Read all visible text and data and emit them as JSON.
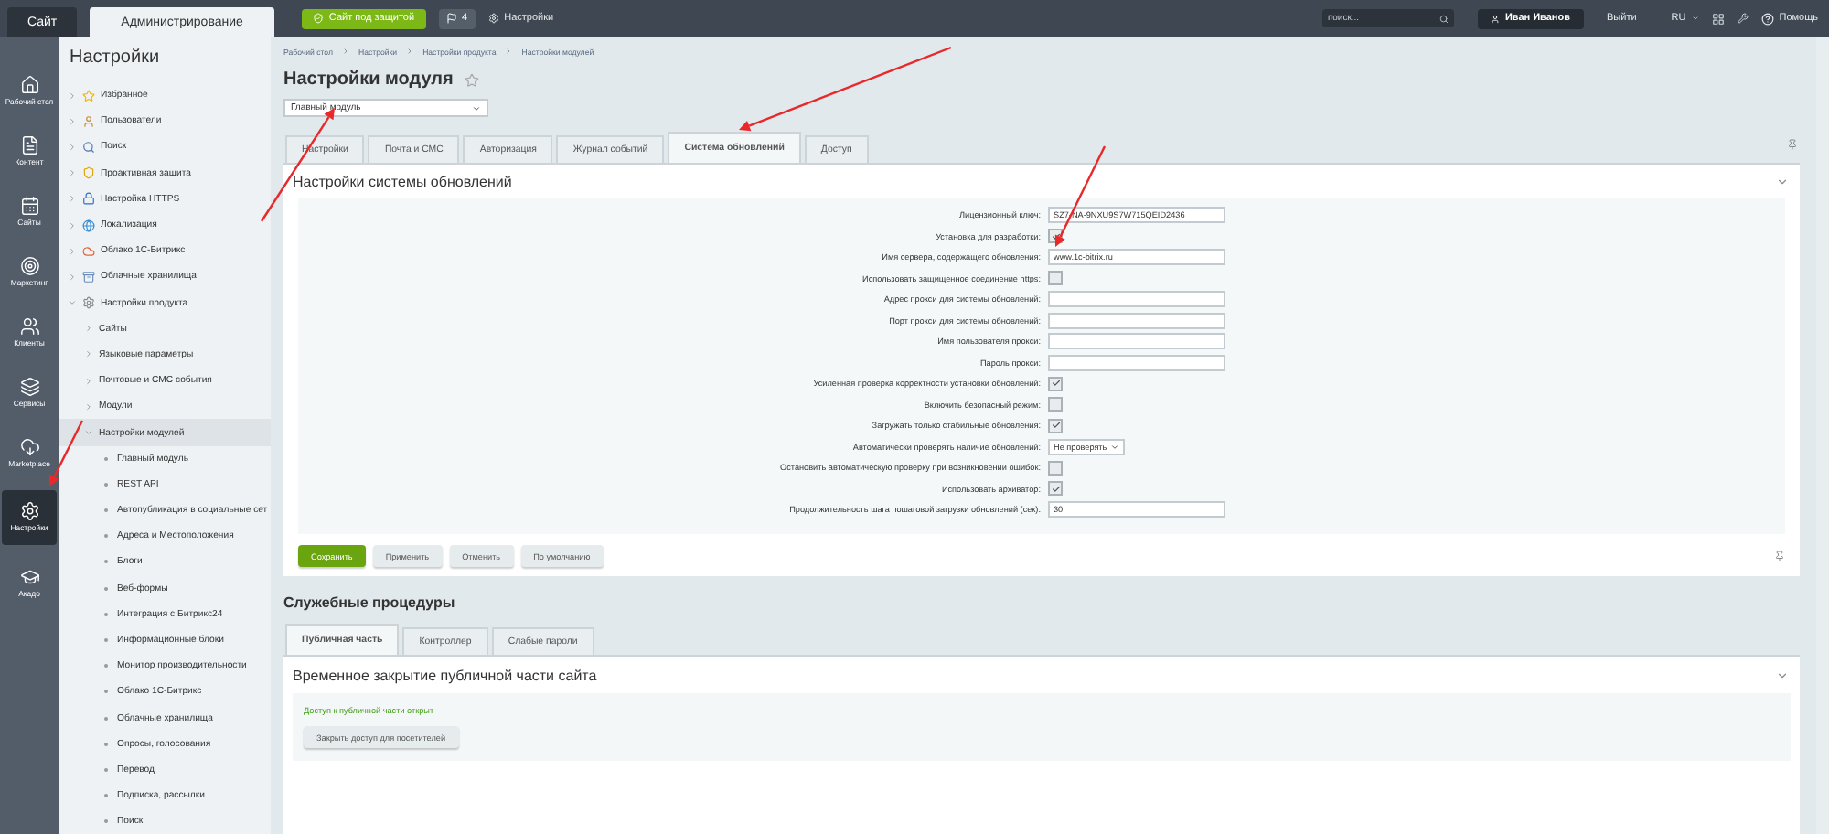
{
  "top_bar": {
    "tabs": [
      {
        "label": "Сайт",
        "selected": false
      },
      {
        "label": "Администрирование",
        "selected": true
      }
    ],
    "protection_button": "Сайт под защитой",
    "notifications_count": "4",
    "settings_link": "Настройки",
    "search": {
      "placeholder": "поиск..."
    },
    "user_name": "Иван Иванов",
    "logout": "Выйти",
    "language": "RU",
    "help": "Помощь"
  },
  "rail": [
    {
      "label": "Рабочий стол",
      "selected": false
    },
    {
      "label": "Контент",
      "selected": false
    },
    {
      "label": "Сайты",
      "selected": false
    },
    {
      "label": "Маркетинг",
      "selected": false
    },
    {
      "label": "Клиенты",
      "selected": false
    },
    {
      "label": "Сервисы",
      "selected": false
    },
    {
      "label": "Marketplace",
      "selected": false
    },
    {
      "label": "Настройки",
      "selected": true
    },
    {
      "label": "Акадо",
      "selected": false
    }
  ],
  "sidebar": {
    "title": "Настройки",
    "items": [
      {
        "label": "Избранное",
        "expanded": false,
        "selected": false
      },
      {
        "label": "Пользователи",
        "expanded": false,
        "selected": false
      },
      {
        "label": "Поиск",
        "expanded": false,
        "selected": false
      },
      {
        "label": "Проактивная защита",
        "expanded": false,
        "selected": false
      },
      {
        "label": "Настройка HTTPS",
        "expanded": false,
        "selected": false
      },
      {
        "label": "Локализация",
        "expanded": false,
        "selected": false
      },
      {
        "label": "Облако 1С-Битрикс",
        "expanded": false,
        "selected": false
      },
      {
        "label": "Облачные хранилища",
        "expanded": false,
        "selected": false
      },
      {
        "label": "Настройки продукта",
        "expanded": true,
        "selected": false,
        "children": [
          {
            "label": "Сайты",
            "expanded": false,
            "selected": false
          },
          {
            "label": "Языковые параметры",
            "expanded": false,
            "selected": false
          },
          {
            "label": "Почтовые и СМС события",
            "expanded": false,
            "selected": false
          },
          {
            "label": "Модули",
            "expanded": false,
            "selected": false
          },
          {
            "label": "Настройки модулей",
            "expanded": true,
            "selected": true,
            "children": [
              {
                "label": "Главный модуль",
                "selected": false
              },
              {
                "label": "REST API",
                "selected": false
              },
              {
                "label": "Автопубликация в социальные сет",
                "selected": false
              },
              {
                "label": "Адреса и Местоположения",
                "selected": false
              },
              {
                "label": "Блоги",
                "selected": false
              },
              {
                "label": "Веб-формы",
                "selected": false
              },
              {
                "label": "Интеграция с Битрикс24",
                "selected": false
              },
              {
                "label": "Информационные блоки",
                "selected": false
              },
              {
                "label": "Монитор производительности",
                "selected": false
              },
              {
                "label": "Облако 1С-Битрикс",
                "selected": false
              },
              {
                "label": "Облачные хранилища",
                "selected": false
              },
              {
                "label": "Опросы, голосования",
                "selected": false
              },
              {
                "label": "Перевод",
                "selected": false
              },
              {
                "label": "Подписка, рассылки",
                "selected": false
              },
              {
                "label": "Поиск",
                "selected": false
              }
            ]
          }
        ]
      }
    ]
  },
  "breadcrumbs": [
    "Рабочий стол",
    "Настройки",
    "Настройки продукта",
    "Настройки модулей"
  ],
  "title": "Настройки модуля",
  "module_select": "Главный модуль",
  "tabs": [
    {
      "label": "Настройки",
      "selected": false
    },
    {
      "label": "Почта и СМС",
      "selected": false
    },
    {
      "label": "Авторизация",
      "selected": false
    },
    {
      "label": "Журнал событий",
      "selected": false
    },
    {
      "label": "Система обновлений",
      "selected": true
    },
    {
      "label": "Доступ",
      "selected": false
    }
  ],
  "settings_card": {
    "title": "Настройки системы обновлений",
    "fields": [
      {
        "kind": "text",
        "label": "Лицензионный ключ:",
        "value": "SZ7-NA-9NXU9S7W715QEID2436"
      },
      {
        "kind": "checkbox",
        "label": "Установка для разработки:",
        "checked": true
      },
      {
        "kind": "text",
        "label": "Имя сервера, содержащего обновления:",
        "value": "www.1c-bitrix.ru"
      },
      {
        "kind": "checkbox",
        "label": "Использовать защищенное соединение https:",
        "checked": false
      },
      {
        "kind": "text",
        "label": "Адрес прокси для системы обновлений:"
      },
      {
        "kind": "text",
        "label": "Порт прокси для системы обновлений:"
      },
      {
        "kind": "text",
        "label": "Имя пользователя прокси:"
      },
      {
        "kind": "text",
        "label": "Пароль прокси:"
      },
      {
        "kind": "checkbox",
        "label": "Усиленная проверка корректности установки обновлений:",
        "checked": true
      },
      {
        "kind": "checkbox",
        "label": "Включить безопасный режим:",
        "checked": false
      },
      {
        "kind": "checkbox",
        "label": "Загружать только стабильные обновления:",
        "checked": true
      },
      {
        "kind": "select",
        "label": "Автоматически проверять наличие обновлений:",
        "value": "Не проверять"
      },
      {
        "kind": "checkbox",
        "label": "Остановить автоматическую проверку при возникновении ошибок:",
        "checked": false
      },
      {
        "kind": "checkbox",
        "label": "Использовать архиватор:",
        "checked": true
      },
      {
        "kind": "text",
        "label": "Продолжительность шага пошаговой загрузки обновлений (сек):",
        "value": "30"
      }
    ],
    "buttons": [
      {
        "label": "Сохранить",
        "kind": "primary"
      },
      {
        "label": "Применить",
        "kind": "default"
      },
      {
        "label": "Отменить",
        "kind": "default"
      },
      {
        "label": "По умолчанию",
        "kind": "default"
      }
    ]
  },
  "service": {
    "title": "Служебные процедуры",
    "tabs": [
      {
        "label": "Публичная часть",
        "selected": true
      },
      {
        "label": "Контроллер",
        "selected": false
      },
      {
        "label": "Слабые пароли",
        "selected": false
      }
    ],
    "panel_title": "Временное закрытие публичной части сайта",
    "status": "Доступ к публичной части открыт",
    "button": "Закрыть доступ для посетителей"
  }
}
